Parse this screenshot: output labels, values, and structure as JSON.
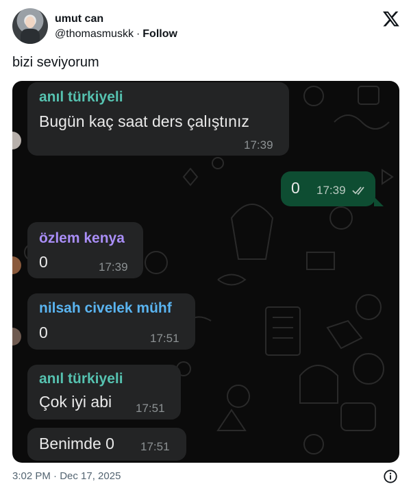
{
  "tweet": {
    "display_name": "umut can",
    "handle": "@thomasmuskk",
    "separator": "·",
    "follow_label": "Follow",
    "text": "bizi seviyorum",
    "timestamp": "3:02 PM · Dec 17, 2025",
    "brand_icon": "x-logo-icon"
  },
  "chat": {
    "messages": [
      {
        "sender": "anıl türkiyeli",
        "sender_color": "#56c2b0",
        "text": "Bugün kaç saat ders çalıştınız",
        "time": "17:39",
        "outgoing": false
      },
      {
        "sender": "",
        "text": "0",
        "time": "17:39",
        "outgoing": true,
        "status": "read-double-check-icon"
      },
      {
        "sender": "özlem kenya",
        "sender_color": "#a98ef7",
        "text": "0",
        "time": "17:39",
        "outgoing": false
      },
      {
        "sender": "nilsah civelek mühf",
        "sender_color": "#5ab4f0",
        "text": "0",
        "time": "17:51",
        "outgoing": false
      },
      {
        "sender": "anıl türkiyeli",
        "sender_color": "#56c2b0",
        "text": "Çok iyi abi",
        "time": "17:51",
        "outgoing": false
      },
      {
        "sender": "",
        "text": "Benimde 0",
        "time": "17:51",
        "outgoing": false
      }
    ]
  },
  "colors": {
    "chat_background": "#0b0b0b",
    "incoming_bubble": "#232425",
    "outgoing_bubble": "#0e4d32"
  }
}
